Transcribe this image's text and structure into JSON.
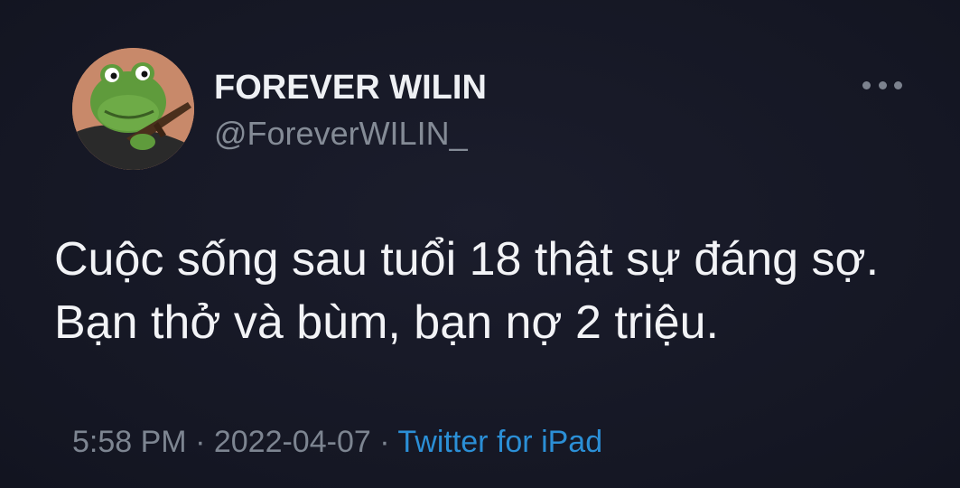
{
  "tweet": {
    "display_name": "FOREVER WILIN",
    "handle": "@ForeverWILIN_",
    "text": "Cuộc sống sau tuổi 18 thật sự đáng sợ. Bạn thở và bùm, bạn nợ 2 triệu.",
    "time": "5:58 PM",
    "date": "2022-04-07",
    "source": "Twitter for iPad",
    "separator": " · ",
    "more_icon": "more-horizontal-icon",
    "colors": {
      "background": "#161826",
      "name": "#eef0f4",
      "handle": "#848b96",
      "text": "#f2f3f6",
      "meta": "#7d8591",
      "source_link": "#2b8fd6"
    }
  }
}
